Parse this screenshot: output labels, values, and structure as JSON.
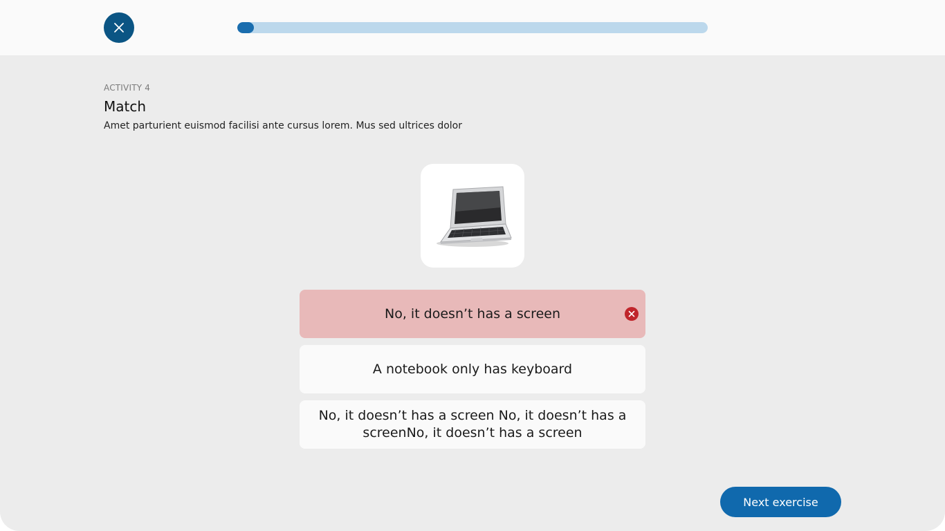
{
  "topbar": {
    "close_icon": "close-icon",
    "progress": 0.035,
    "colors": {
      "close_bg": "#0b5584",
      "track": "#bcd8ec",
      "fill": "#1a6dae"
    }
  },
  "activity": {
    "label": "ACTIVITY 4",
    "title": "Match",
    "description": "Amet parturient euismod facilisi ante cursus lorem. Mus sed ultrices dolor"
  },
  "image": {
    "icon": "laptop-image"
  },
  "options": [
    {
      "text": "No, it doesn’t has a screen",
      "state": "incorrect",
      "icon": "error-circle-icon"
    },
    {
      "text": "A notebook only has keyboard",
      "state": "default"
    },
    {
      "text": "No, it doesn’t has a screen No, it doesn’t has a screenNo, it doesn’t has a screen",
      "state": "default"
    }
  ],
  "footer": {
    "next_label": "Next exercise"
  },
  "colors": {
    "wrong_bg": "#e8b9b9",
    "error_red": "#c0252b",
    "primary": "#1069ad"
  }
}
